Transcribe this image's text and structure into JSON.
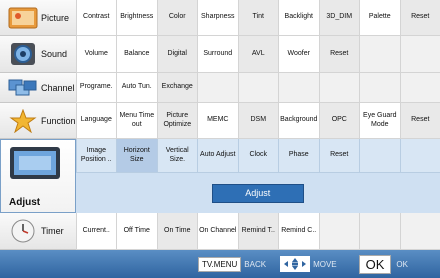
{
  "rows": {
    "picture": {
      "label": "Picture",
      "items": [
        "Contrast",
        "Brightness",
        "Color",
        "Sharpness",
        "Tint",
        "Backlight",
        "3D_DIM",
        "Palette",
        "Reset"
      ]
    },
    "sound": {
      "label": "Sound",
      "items": [
        "Volume",
        "Balance",
        "Digital",
        "Surround",
        "AVL",
        "Woofer",
        "Reset",
        "",
        ""
      ]
    },
    "channel": {
      "label": "Channel",
      "items": [
        "Programe.",
        "Auto Tun.",
        "Exchange",
        "",
        "",
        "",
        "",
        "",
        ""
      ]
    },
    "function": {
      "label": "Function",
      "items": [
        "Language",
        "Menu Time out",
        "Picture Optimize",
        "MEMC",
        "DSM",
        "Background",
        "OPC",
        "Eye Guard Mode",
        "Reset"
      ]
    },
    "adjust": {
      "label": "Adjust",
      "items": [
        "Image Position ..",
        "Horizont Size",
        "Vertical Size.",
        "Auto Adjust",
        "Clock",
        "Phase",
        "Reset",
        "",
        ""
      ],
      "bar_label": "Adjust"
    },
    "timer": {
      "label": "Timer",
      "items": [
        "Current..",
        "Off Time",
        "On Time",
        "On Channel",
        "Remind T..",
        "Remind C..",
        "",
        "",
        ""
      ]
    }
  },
  "bottom": {
    "tvmenu": "TV.MENU",
    "back": "BACK",
    "move": "MOVE",
    "ok": "OK",
    "ok_text": "OK"
  }
}
